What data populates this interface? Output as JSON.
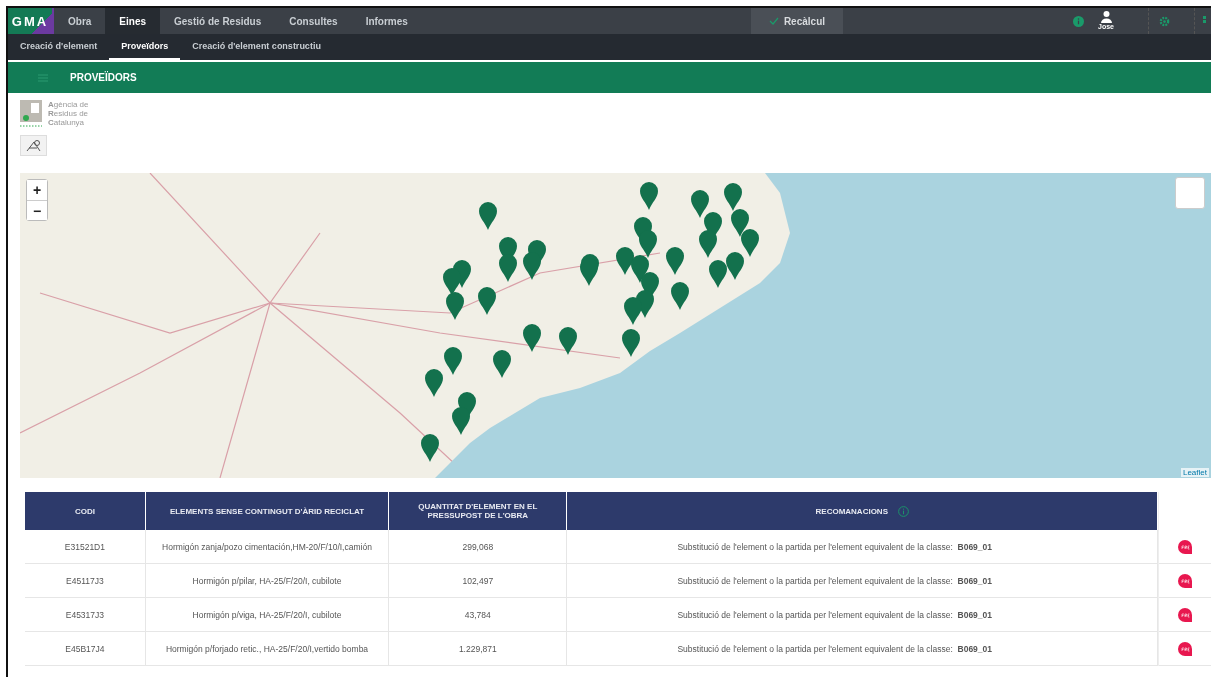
{
  "top_nav": {
    "logo": "GMA",
    "items": [
      {
        "label": "Obra",
        "selected": false
      },
      {
        "label": "Eines",
        "selected": true
      },
      {
        "label": "Gestió de Residus",
        "selected": false
      },
      {
        "label": "Consultes",
        "selected": false
      },
      {
        "label": "Informes",
        "selected": false
      }
    ],
    "recalc_button": "Recàlcul",
    "user": "Jose"
  },
  "sub_nav": {
    "items": [
      {
        "label": "Creació d'element",
        "selected": false
      },
      {
        "label": "Proveïdors",
        "selected": true
      },
      {
        "label": "Creació d'element constructiu",
        "selected": false
      }
    ]
  },
  "section": {
    "title": "PROVEÏDORS"
  },
  "agency_logo": {
    "lines": [
      "**A**gència de",
      "**R**esidus de",
      "**C**atalunya"
    ]
  },
  "map": {
    "zoom_in": "+",
    "zoom_out": "−",
    "attribution": "Leaflet"
  },
  "table": {
    "columns": [
      "CODI",
      "ELEMENTS SENSE CONTINGUT D'ÀRID RECICLAT",
      "QUANTITAT D'ELEMENT EN EL PRESSUPOST DE L'OBRA",
      "RECOMANACIONS"
    ],
    "rows": [
      {
        "codi": "E31521D1",
        "element": "Hormigón zanja/pozo cimentación,HM-20/F/10/I,camión",
        "quantitat": "299,068",
        "recomanacio": "Substitució de l'element o la partida per l'element equivalent de la classe:  **B069_01**"
      },
      {
        "codi": "E45117J3",
        "element": "Hormigón p/pilar, HA-25/F/20/I, cubilote",
        "quantitat": "102,497",
        "recomanacio": "Substitució de l'element o la partida per l'element equivalent de la classe:  **B069_01**"
      },
      {
        "codi": "E45317J3",
        "element": "Hormigón p/viga, HA-25/F/20/I, cubilote",
        "quantitat": "43,784",
        "recomanacio": "Substitució de l'element o la partida per l'element equivalent de la classe:  **B069_01**"
      },
      {
        "codi": "E45B17J4",
        "element": "Hormigón p/forjado retic., HA-25/F/20/I,vertido bomba",
        "quantitat": "1.229,871",
        "recomanacio": "Substitució de l'element o la partida per l'element equivalent de la classe:  **B069_01**"
      }
    ]
  }
}
